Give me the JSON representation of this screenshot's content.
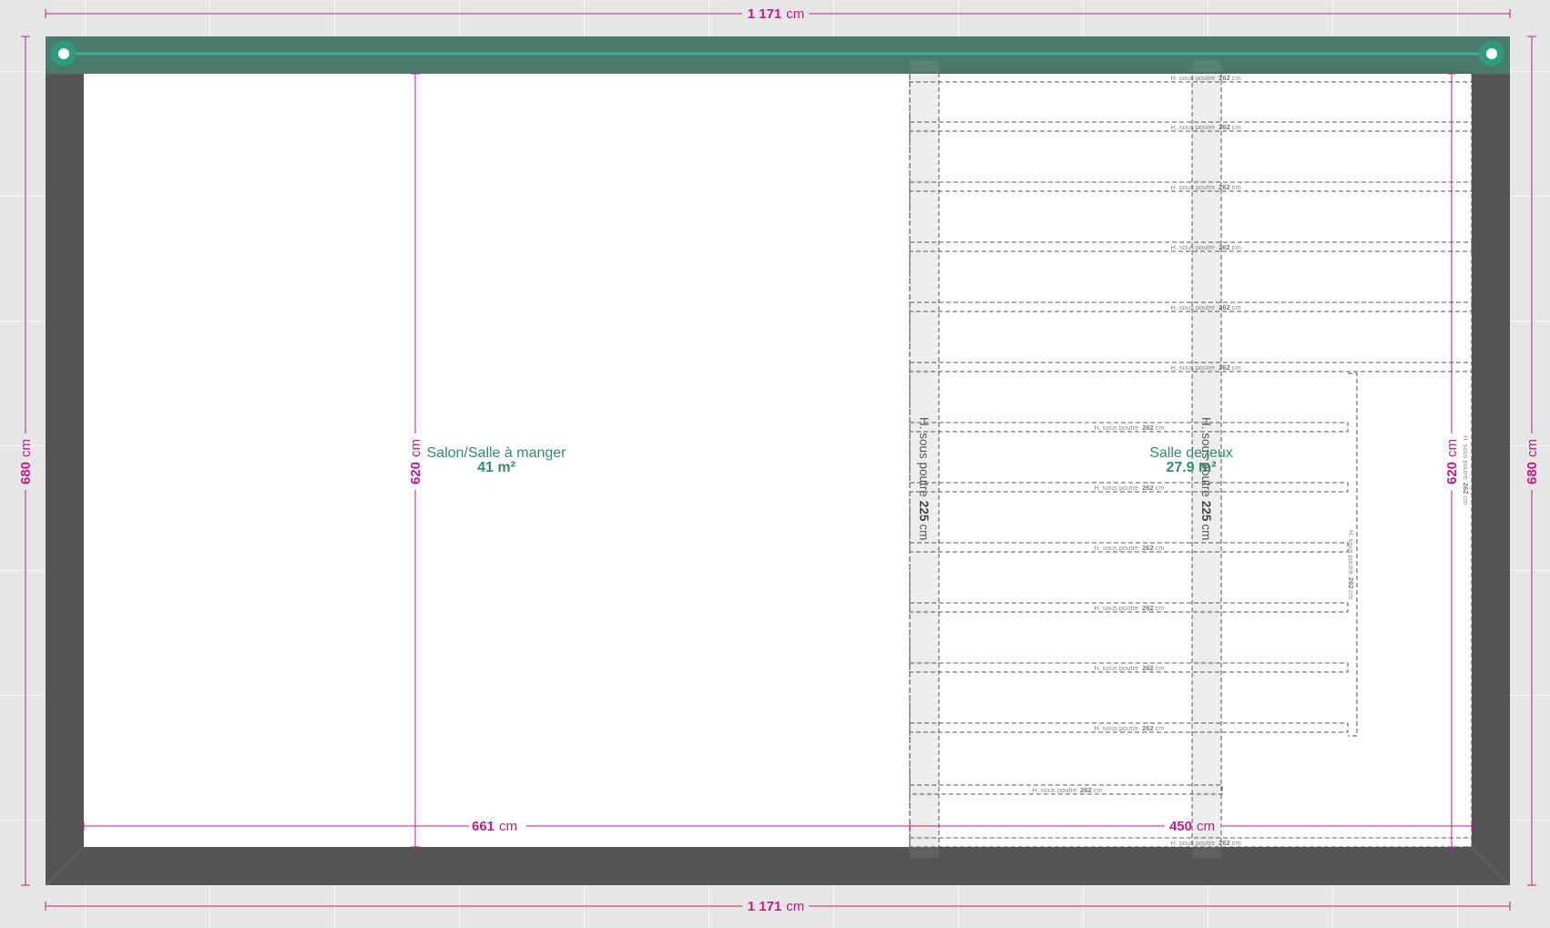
{
  "dimensions": {
    "total_width_value": "1 171",
    "total_height_value": "680",
    "interior_height_value": "620",
    "salon_width_value": "661",
    "jeux_width_value": "450",
    "unit": "cm"
  },
  "rooms": [
    {
      "name": "Salon/Salle à manger",
      "area": "41 m²"
    },
    {
      "name": "Salle de jeux",
      "area": "27.9 m²"
    }
  ],
  "beams": {
    "label": "H. sous poutre",
    "value": "262",
    "unit": "cm",
    "vertical_value": "225"
  },
  "colors": {
    "wall": "#555555",
    "wall_top": "#4a7a6c",
    "accent": "#2e8b72",
    "dimension": "#c51a8a",
    "floor": "#ffffff",
    "background": "#e6e6e6"
  }
}
